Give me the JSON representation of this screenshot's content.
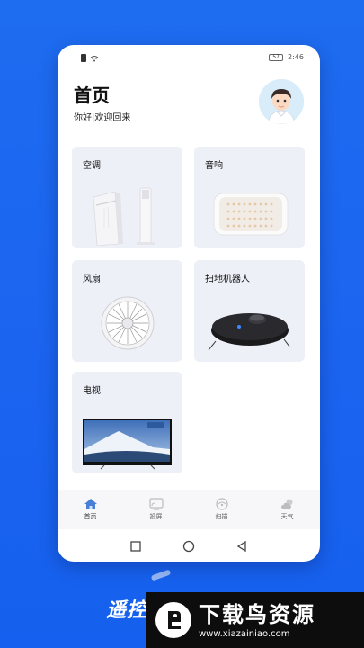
{
  "status_bar": {
    "time": "2:46",
    "battery": "57"
  },
  "header": {
    "title": "首页",
    "subtitle": "你好|欢迎回来"
  },
  "cards": [
    {
      "label": "空调",
      "icon": "air-conditioner"
    },
    {
      "label": "音响",
      "icon": "speaker"
    },
    {
      "label": "风扇",
      "icon": "fan"
    },
    {
      "label": "扫地机器人",
      "icon": "robot-vacuum"
    },
    {
      "label": "电视",
      "icon": "television"
    }
  ],
  "bottom_nav": [
    {
      "label": "首页",
      "icon": "home-icon",
      "active": true
    },
    {
      "label": "投屏",
      "icon": "cast-icon",
      "active": false
    },
    {
      "label": "扫描",
      "icon": "scan-icon",
      "active": false
    },
    {
      "label": "天气",
      "icon": "weather-icon",
      "active": false
    }
  ],
  "banner": {
    "text": "遥控"
  },
  "watermark": {
    "title": "下载鸟资源",
    "url": "www.xiazainiao.com"
  },
  "colors": {
    "background": "#1b64f0",
    "card": "#eef0f8",
    "nav_active": "#4a7fd8"
  }
}
